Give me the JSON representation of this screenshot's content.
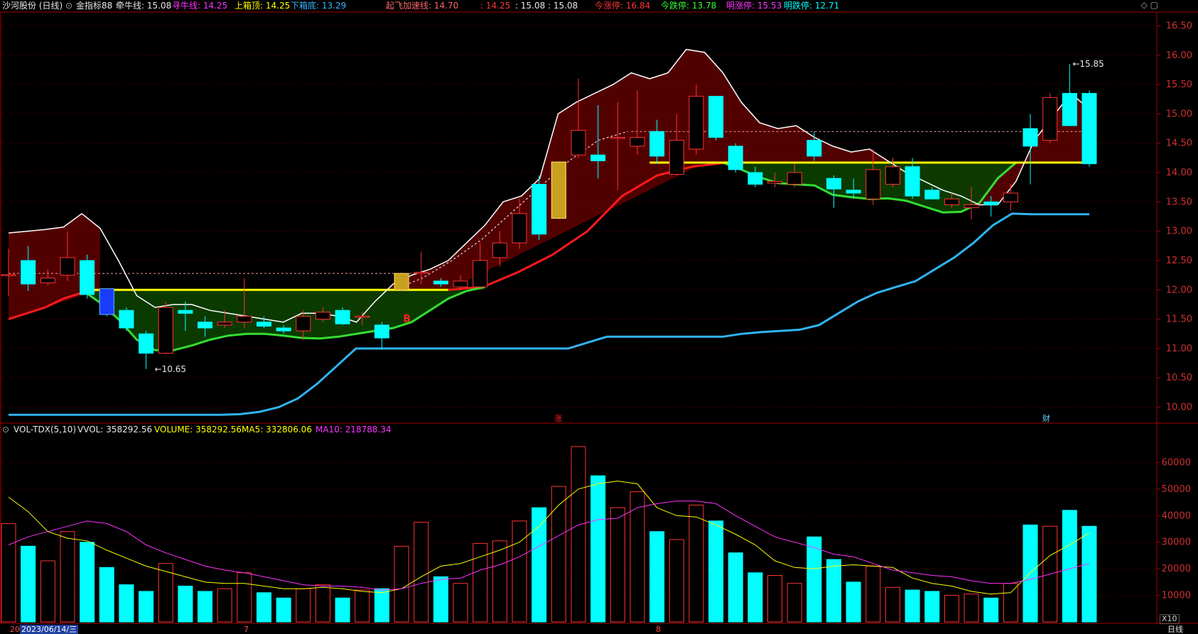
{
  "header": {
    "stock_name": "沙河股份 (日线)",
    "indicator_name": "金指标88",
    "items": [
      {
        "label": "牵牛线: 15.08",
        "color": "#e6e6e6"
      },
      {
        "label": "寻牛线: 14.25",
        "color": "#ff33ff"
      },
      {
        "label": "上箱顶: 14.25",
        "color": "#ffff00"
      },
      {
        "label": "下箱底: 13.29",
        "color": "#33b5ff"
      },
      {
        "label": "起飞加速线: 14.70",
        "color": "#ff6666"
      },
      {
        "label": ": 14.25",
        "color": "#ff3333"
      },
      {
        "label": ": 15.08 : 15.08",
        "color": "#e6e6e6"
      },
      {
        "label": "今涨停: 16.84",
        "color": "#ff3333"
      },
      {
        "label": "今跌停: 13.78",
        "color": "#33ff33"
      },
      {
        "label": "明涨停: 15.53",
        "color": "#ff33ff"
      },
      {
        "label": "明跌停: 12.71",
        "color": "#00ffff"
      }
    ]
  },
  "volume_header": {
    "name": "VOL-TDX(5,10)",
    "items": [
      {
        "label": "VVOL: 358292.56",
        "color": "#e6e6e6"
      },
      {
        "label": "VOLUME: 358292.56",
        "color": "#ffff00"
      },
      {
        "label": "MA5: 332806.06",
        "color": "#ffff00"
      },
      {
        "label": "MA10: 218788.34",
        "color": "#ff33ff"
      }
    ]
  },
  "bottom_bar": {
    "left_label": "20",
    "date_label": "2023/06/14/三",
    "month_7": "7",
    "month_8": "8",
    "period": "日线",
    "vol_unit": "X10"
  },
  "annotations": {
    "low_label": "10.65",
    "high_label": "15.85",
    "buy_marker": "B",
    "event_zhang": "涨",
    "event_cai": "财"
  },
  "colors": {
    "up": "#ff3333",
    "down": "#00ffff",
    "white_line": "#ffffff",
    "red_line": "#ff1a1a",
    "green_line": "#33dd33",
    "blue_line": "#2fb4f0",
    "yellow_line": "#ffff00",
    "upper_fill": "#5a0000",
    "lower_fill": "#0b3d00"
  },
  "chart_data": [
    {
      "type": "candlestick",
      "title": "沙河股份 (日线)",
      "y_ticks": [
        10.0,
        10.5,
        11.0,
        11.5,
        12.0,
        12.5,
        13.0,
        13.5,
        14.0,
        14.5,
        15.0,
        15.5,
        16.0,
        16.5
      ],
      "ylim": [
        9.8,
        16.7
      ],
      "candles": [
        {
          "o": 12.26,
          "h": 12.7,
          "l": 11.9,
          "c": 12.26
        },
        {
          "o": 12.5,
          "h": 12.75,
          "l": 11.98,
          "c": 12.1
        },
        {
          "o": 12.12,
          "h": 12.35,
          "l": 12.08,
          "c": 12.2
        },
        {
          "o": 12.25,
          "h": 13.0,
          "l": 12.15,
          "c": 12.55
        },
        {
          "o": 12.5,
          "h": 12.6,
          "l": 11.85,
          "c": 11.92
        },
        {
          "o": 12.0,
          "h": 12.02,
          "l": 11.55,
          "c": 11.58
        },
        {
          "o": 11.65,
          "h": 11.7,
          "l": 11.3,
          "c": 11.35
        },
        {
          "o": 11.25,
          "h": 11.3,
          "l": 10.65,
          "c": 10.92
        },
        {
          "o": 10.92,
          "h": 11.8,
          "l": 10.9,
          "c": 11.7
        },
        {
          "o": 11.65,
          "h": 11.8,
          "l": 11.3,
          "c": 11.6
        },
        {
          "o": 11.45,
          "h": 11.55,
          "l": 11.2,
          "c": 11.35
        },
        {
          "o": 11.4,
          "h": 11.65,
          "l": 11.35,
          "c": 11.45
        },
        {
          "o": 11.45,
          "h": 12.2,
          "l": 11.35,
          "c": 11.55
        },
        {
          "o": 11.45,
          "h": 11.55,
          "l": 11.35,
          "c": 11.38
        },
        {
          "o": 11.35,
          "h": 11.4,
          "l": 11.25,
          "c": 11.3
        },
        {
          "o": 11.3,
          "h": 11.65,
          "l": 11.15,
          "c": 11.55
        },
        {
          "o": 11.5,
          "h": 11.7,
          "l": 11.45,
          "c": 11.62
        },
        {
          "o": 11.65,
          "h": 11.7,
          "l": 11.4,
          "c": 11.42
        },
        {
          "o": 11.55,
          "h": 11.62,
          "l": 11.4,
          "c": 11.55
        },
        {
          "o": 11.4,
          "h": 11.45,
          "l": 10.98,
          "c": 11.18
        },
        {
          "o": 12.0,
          "h": 12.3,
          "l": 11.98,
          "c": 12.28
        },
        {
          "o": 12.3,
          "h": 12.65,
          "l": 12.1,
          "c": 12.3
        },
        {
          "o": 12.15,
          "h": 12.2,
          "l": 12.05,
          "c": 12.1
        },
        {
          "o": 12.05,
          "h": 12.25,
          "l": 12.0,
          "c": 12.15
        },
        {
          "o": 12.05,
          "h": 12.8,
          "l": 12.0,
          "c": 12.5
        },
        {
          "o": 12.55,
          "h": 13.0,
          "l": 12.4,
          "c": 12.8
        },
        {
          "o": 12.8,
          "h": 13.55,
          "l": 12.7,
          "c": 13.3
        },
        {
          "o": 13.8,
          "h": 13.95,
          "l": 12.85,
          "c": 12.95
        },
        {
          "o": 13.22,
          "h": 14.18,
          "l": 13.2,
          "c": 14.18
        },
        {
          "o": 14.3,
          "h": 15.6,
          "l": 14.25,
          "c": 14.72
        },
        {
          "o": 14.3,
          "h": 15.15,
          "l": 13.9,
          "c": 14.2
        },
        {
          "o": 14.6,
          "h": 15.2,
          "l": 13.7,
          "c": 14.6
        },
        {
          "o": 14.45,
          "h": 15.4,
          "l": 14.3,
          "c": 14.6
        },
        {
          "o": 14.7,
          "h": 14.9,
          "l": 14.15,
          "c": 14.28
        },
        {
          "o": 13.97,
          "h": 15.0,
          "l": 13.95,
          "c": 14.55
        },
        {
          "o": 14.4,
          "h": 15.5,
          "l": 14.3,
          "c": 15.3
        },
        {
          "o": 15.3,
          "h": 15.3,
          "l": 14.55,
          "c": 14.6
        },
        {
          "o": 14.45,
          "h": 14.5,
          "l": 14.0,
          "c": 14.05
        },
        {
          "o": 14.0,
          "h": 14.1,
          "l": 13.75,
          "c": 13.8
        },
        {
          "o": 13.82,
          "h": 14.0,
          "l": 13.75,
          "c": 13.85
        },
        {
          "o": 13.8,
          "h": 14.15,
          "l": 13.75,
          "c": 14.0
        },
        {
          "o": 14.55,
          "h": 14.7,
          "l": 14.2,
          "c": 14.28
        },
        {
          "o": 13.9,
          "h": 13.95,
          "l": 13.4,
          "c": 13.72
        },
        {
          "o": 13.7,
          "h": 13.9,
          "l": 13.55,
          "c": 13.65
        },
        {
          "o": 13.55,
          "h": 14.4,
          "l": 13.45,
          "c": 14.05
        },
        {
          "o": 13.8,
          "h": 14.25,
          "l": 13.75,
          "c": 14.1
        },
        {
          "o": 14.1,
          "h": 14.25,
          "l": 13.55,
          "c": 13.6
        },
        {
          "o": 13.7,
          "h": 13.75,
          "l": 13.55,
          "c": 13.55
        },
        {
          "o": 13.45,
          "h": 13.65,
          "l": 13.4,
          "c": 13.55
        },
        {
          "o": 13.4,
          "h": 13.75,
          "l": 13.2,
          "c": 13.45
        },
        {
          "o": 13.5,
          "h": 13.6,
          "l": 13.25,
          "c": 13.45
        },
        {
          "o": 13.5,
          "h": 13.8,
          "l": 13.35,
          "c": 13.65
        },
        {
          "o": 14.75,
          "h": 15.0,
          "l": 13.8,
          "c": 14.45
        },
        {
          "o": 14.55,
          "h": 15.35,
          "l": 14.5,
          "c": 15.28
        },
        {
          "o": 15.35,
          "h": 15.85,
          "l": 14.8,
          "c": 14.8
        },
        {
          "o": 15.35,
          "h": 15.4,
          "l": 14.1,
          "c": 14.15
        }
      ],
      "white_line": [
        12.97,
        13.0,
        13.03,
        13.07,
        13.3,
        13.05,
        12.5,
        11.9,
        11.7,
        11.75,
        11.75,
        11.65,
        11.6,
        11.55,
        11.5,
        11.45,
        11.6,
        11.6,
        11.55,
        11.45,
        11.8,
        12.1,
        12.25,
        12.35,
        12.5,
        12.8,
        13.1,
        13.5,
        13.6,
        13.9,
        15.0,
        15.2,
        15.35,
        15.5,
        15.7,
        15.6,
        15.7,
        16.1,
        16.05,
        15.7,
        15.2,
        14.85,
        14.75,
        14.8,
        14.6,
        14.45,
        14.35,
        14.4,
        14.2,
        14.0,
        13.85,
        13.7,
        13.6,
        13.45,
        13.45,
        13.85,
        14.55,
        14.95,
        15.35,
        15.08
      ],
      "red_line": [
        11.5,
        11.6,
        11.7,
        11.85,
        11.95,
        12.0
      ],
      "green_line": [
        12.0,
        11.78,
        11.5,
        11.15,
        10.97,
        10.97,
        11.05,
        11.15,
        11.22,
        11.25,
        11.25,
        11.22,
        11.18,
        11.17,
        11.2,
        11.25,
        11.3,
        11.35,
        11.45,
        11.65,
        11.85,
        11.98,
        12.05
      ],
      "blue_line": [
        9.87,
        9.87,
        9.87,
        9.87,
        9.87,
        9.87,
        9.87,
        9.87,
        9.87,
        9.87,
        9.87,
        9.87,
        9.88,
        9.92,
        10.0,
        10.15,
        10.4,
        10.7,
        11.0,
        11.0,
        11.0,
        11.0,
        11.0,
        11.0,
        11.0,
        11.0,
        11.0,
        11.0,
        11.0,
        11.0,
        11.1,
        11.2,
        11.2,
        11.2,
        11.2,
        11.2,
        11.2,
        11.2,
        11.25,
        11.28,
        11.3,
        11.32,
        11.4,
        11.6,
        11.8,
        11.95,
        12.05,
        12.15,
        12.35,
        12.55,
        12.8,
        13.1,
        13.3,
        13.29,
        13.29,
        13.29,
        13.29
      ],
      "yellow_level_1": 12.0,
      "yellow_level_2": 14.17,
      "dashed_levels": [
        12.28,
        14.7
      ],
      "last_value": 15.08
    },
    {
      "type": "bar",
      "title": "VOL-TDX(5,10)",
      "y_ticks": [
        10000,
        20000,
        30000,
        40000,
        50000,
        60000
      ],
      "ylim": [
        0,
        70000
      ],
      "volumes": [
        37000,
        28500,
        23000,
        34000,
        30000,
        20500,
        14000,
        11500,
        22000,
        13500,
        11500,
        12500,
        18500,
        11000,
        9000,
        12500,
        14000,
        9000,
        12000,
        12500,
        28500,
        37500,
        17000,
        14500,
        29500,
        30500,
        38000,
        43000,
        51000,
        66000,
        55000,
        43000,
        49000,
        34000,
        31000,
        44000,
        38000,
        26000,
        18500,
        17500,
        14500,
        32000,
        23500,
        15000,
        21000,
        13000,
        12000,
        11500,
        10000,
        10500,
        9000,
        14500,
        36500,
        36000,
        42000,
        36000
      ],
      "ma5": [
        47000,
        41500,
        34000,
        31500,
        30500,
        27000,
        24000,
        21000,
        19000,
        17000,
        15000,
        14500,
        14500,
        13500,
        12500,
        12500,
        13000,
        12500,
        11500,
        11000,
        12500,
        17000,
        21000,
        22000,
        24500,
        27000,
        30000,
        36000,
        44000,
        50000,
        52000,
        53000,
        52000,
        43000,
        40000,
        39500,
        36500,
        33000,
        29000,
        23000,
        20500,
        20000,
        21000,
        21500,
        21000,
        20500,
        16500,
        14500,
        13500,
        11500,
        10500,
        11000,
        18500,
        25000,
        29000,
        33500
      ],
      "ma10": [
        29000,
        32000,
        34000,
        36000,
        38000,
        37000,
        34000,
        29000,
        26000,
        23500,
        21000,
        19500,
        18500,
        17000,
        15500,
        14000,
        13500,
        13500,
        13000,
        12000,
        12500,
        14500,
        16000,
        16500,
        19500,
        21500,
        24500,
        28500,
        32500,
        36500,
        38500,
        39000,
        43000,
        44500,
        45500,
        45500,
        44500,
        40000,
        36000,
        32000,
        30000,
        28000,
        25500,
        24500,
        22000,
        19500,
        18500,
        17500,
        17000,
        15500,
        14500,
        14500,
        16000,
        18000,
        20000,
        22000
      ]
    }
  ]
}
